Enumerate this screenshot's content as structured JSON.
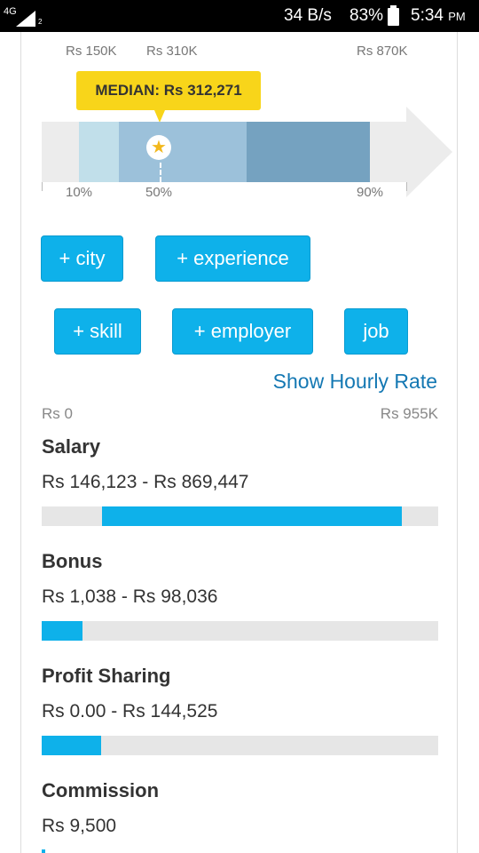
{
  "status_bar": {
    "network": "4G",
    "sim": "2",
    "speed": "34 B/s",
    "battery": "83%",
    "time": "5:34",
    "ampm": "PM"
  },
  "range_chart": {
    "top_labels": [
      "Rs 150K",
      "Rs 310K",
      "Rs 870K"
    ],
    "median_label": "MEDIAN: Rs 312,271",
    "percentile_labels": [
      "10%",
      "50%",
      "90%"
    ],
    "median_icon": "star-icon",
    "colors": {
      "band_light": "#c1dfea",
      "band_mid": "#9cc1da",
      "band_dark": "#75a2c0",
      "callout": "#f8d51a"
    }
  },
  "filters": {
    "city": "+ city",
    "experience": "+ experience",
    "skill": "+ skill",
    "employer": "+ employer",
    "job": "job",
    "color": "#0eb1ea"
  },
  "hourly_link": "Show Hourly Rate",
  "scale": {
    "min": "Rs 0",
    "max": "Rs 955K"
  },
  "compensation": [
    {
      "title": "Salary",
      "range": "Rs 146,123 - Rs 869,447",
      "bar_start_fraction": 0.153,
      "bar_end_fraction": 0.91
    },
    {
      "title": "Bonus",
      "range": "Rs 1,038 - Rs 98,036",
      "bar_start_fraction": 0.0,
      "bar_end_fraction": 0.103
    },
    {
      "title": "Profit Sharing",
      "range": "Rs 0.00 - Rs 144,525",
      "bar_start_fraction": 0.0,
      "bar_end_fraction": 0.151
    },
    {
      "title": "Commission",
      "range": "Rs 9,500"
    }
  ]
}
